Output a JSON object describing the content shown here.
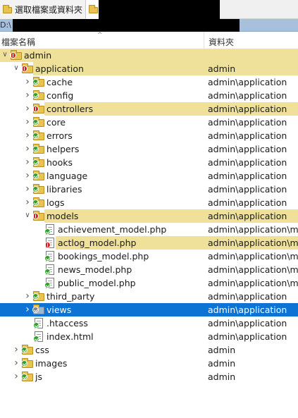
{
  "tabs": [
    {
      "label": "選取檔案或資料夾",
      "active": false
    },
    {
      "label": "",
      "active": true
    }
  ],
  "address": {
    "text": "D:\\"
  },
  "columns": {
    "name": "檔案名稱",
    "folder": "資料夾"
  },
  "colors": {
    "highlight": "#f0e19a",
    "selected": "#0a73d3",
    "folder": "#e9c34f",
    "conflict": "#d42222",
    "normal": "#34a02b",
    "ignored": "#7a8490"
  },
  "tree": [
    {
      "name": "admin",
      "folder": "",
      "indent": 0,
      "expand": "open",
      "type": "folder",
      "status": "red",
      "highlight": true
    },
    {
      "name": "application",
      "folder": "admin",
      "indent": 1,
      "expand": "open",
      "type": "folder",
      "status": "red",
      "highlight": true
    },
    {
      "name": "cache",
      "folder": "admin\\application",
      "indent": 2,
      "expand": "closed",
      "type": "folder",
      "status": "green"
    },
    {
      "name": "config",
      "folder": "admin\\application",
      "indent": 2,
      "expand": "closed",
      "type": "folder",
      "status": "green"
    },
    {
      "name": "controllers",
      "folder": "admin\\application",
      "indent": 2,
      "expand": "closed",
      "type": "folder",
      "status": "red",
      "highlight": true
    },
    {
      "name": "core",
      "folder": "admin\\application",
      "indent": 2,
      "expand": "closed",
      "type": "folder",
      "status": "green"
    },
    {
      "name": "errors",
      "folder": "admin\\application",
      "indent": 2,
      "expand": "closed",
      "type": "folder",
      "status": "green"
    },
    {
      "name": "helpers",
      "folder": "admin\\application",
      "indent": 2,
      "expand": "closed",
      "type": "folder",
      "status": "green"
    },
    {
      "name": "hooks",
      "folder": "admin\\application",
      "indent": 2,
      "expand": "closed",
      "type": "folder",
      "status": "green"
    },
    {
      "name": "language",
      "folder": "admin\\application",
      "indent": 2,
      "expand": "closed",
      "type": "folder",
      "status": "green"
    },
    {
      "name": "libraries",
      "folder": "admin\\application",
      "indent": 2,
      "expand": "closed",
      "type": "folder",
      "status": "green"
    },
    {
      "name": "logs",
      "folder": "admin\\application",
      "indent": 2,
      "expand": "closed",
      "type": "folder",
      "status": "green"
    },
    {
      "name": "models",
      "folder": "admin\\application",
      "indent": 2,
      "expand": "open",
      "type": "folder",
      "status": "red",
      "highlight": true
    },
    {
      "name": "achievement_model.php",
      "folder": "admin\\application\\m...",
      "indent": 3,
      "expand": "none",
      "type": "file",
      "status": "green"
    },
    {
      "name": "actlog_model.php",
      "folder": "admin\\application\\m...",
      "indent": 3,
      "expand": "none",
      "type": "file",
      "status": "red",
      "highlight": true
    },
    {
      "name": "bookings_model.php",
      "folder": "admin\\application\\m...",
      "indent": 3,
      "expand": "none",
      "type": "file",
      "status": "green"
    },
    {
      "name": "news_model.php",
      "folder": "admin\\application\\m...",
      "indent": 3,
      "expand": "none",
      "type": "file",
      "status": "green"
    },
    {
      "name": "public_model.php",
      "folder": "admin\\application\\m...",
      "indent": 3,
      "expand": "none",
      "type": "file",
      "status": "green"
    },
    {
      "name": "third_party",
      "folder": "admin\\application",
      "indent": 2,
      "expand": "closed",
      "type": "folder",
      "status": "green"
    },
    {
      "name": "views",
      "folder": "admin\\application",
      "indent": 2,
      "expand": "closed",
      "type": "folder",
      "status": "grey",
      "selected": true
    },
    {
      "name": ".htaccess",
      "folder": "admin\\application",
      "indent": 2,
      "expand": "none",
      "type": "file",
      "status": "green"
    },
    {
      "name": "index.html",
      "folder": "admin\\application",
      "indent": 2,
      "expand": "none",
      "type": "file",
      "status": "green"
    },
    {
      "name": "css",
      "folder": "admin",
      "indent": 1,
      "expand": "closed",
      "type": "folder",
      "status": "green"
    },
    {
      "name": "images",
      "folder": "admin",
      "indent": 1,
      "expand": "closed",
      "type": "folder",
      "status": "green"
    },
    {
      "name": "js",
      "folder": "admin",
      "indent": 1,
      "expand": "closed",
      "type": "folder",
      "status": "green"
    }
  ]
}
